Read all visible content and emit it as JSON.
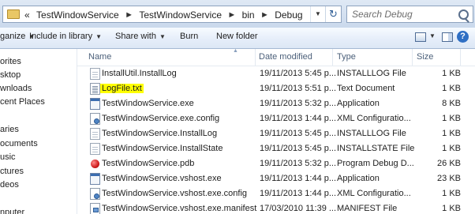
{
  "address": {
    "breadcrumb_prefix": "«",
    "crumbs": [
      "TestWindowService",
      "TestWindowService",
      "bin",
      "Debug"
    ],
    "separator": "►"
  },
  "search": {
    "placeholder": "Search Debug"
  },
  "toolbar": {
    "organize_label": "ganize",
    "include_label": "Include in library",
    "share_label": "Share with",
    "burn_label": "Burn",
    "newfolder_label": "New folder"
  },
  "nav": {
    "items": [
      "orites",
      "sktop",
      "wnloads",
      "cent Places",
      "aries",
      "ocuments",
      "usic",
      "ctures",
      "deos",
      "nputer"
    ]
  },
  "columns": {
    "name": "Name",
    "date": "Date modified",
    "type": "Type",
    "size": "Size"
  },
  "files": [
    {
      "name": "InstallUtil.InstallLog",
      "date": "19/11/2013 5:45 p...",
      "type": "INSTALLLOG File",
      "size": "1 KB",
      "icon": "document-icon"
    },
    {
      "name": "LogFile.txt",
      "date": "19/11/2013 5:51 p...",
      "type": "Text Document",
      "size": "1 KB",
      "icon": "text-file-icon"
    },
    {
      "name": "TestWindowService.exe",
      "date": "19/11/2013 5:32 p...",
      "type": "Application",
      "size": "8 KB",
      "icon": "exe-icon"
    },
    {
      "name": "TestWindowService.exe.config",
      "date": "19/11/2013 1:44 p...",
      "type": "XML Configuratio...",
      "size": "1 KB",
      "icon": "config-icon"
    },
    {
      "name": "TestWindowService.InstallLog",
      "date": "19/11/2013 5:45 p...",
      "type": "INSTALLLOG File",
      "size": "1 KB",
      "icon": "document-icon"
    },
    {
      "name": "TestWindowService.InstallState",
      "date": "19/11/2013 5:45 p...",
      "type": "INSTALLSTATE File",
      "size": "1 KB",
      "icon": "document-icon"
    },
    {
      "name": "TestWindowService.pdb",
      "date": "19/11/2013 5:32 p...",
      "type": "Program Debug D...",
      "size": "26 KB",
      "icon": "pdb-icon"
    },
    {
      "name": "TestWindowService.vshost.exe",
      "date": "19/11/2013 1:44 p...",
      "type": "Application",
      "size": "23 KB",
      "icon": "exe-icon"
    },
    {
      "name": "TestWindowService.vshost.exe.config",
      "date": "19/11/2013 1:44 p...",
      "type": "XML Configuratio...",
      "size": "1 KB",
      "icon": "config-icon"
    },
    {
      "name": "TestWindowService.vshost.exe.manifest",
      "date": "17/03/2010 11:39 ...",
      "type": "MANIFEST File",
      "size": "1 KB",
      "icon": "manifest-icon"
    }
  ],
  "highlight_color": "#ffff00"
}
